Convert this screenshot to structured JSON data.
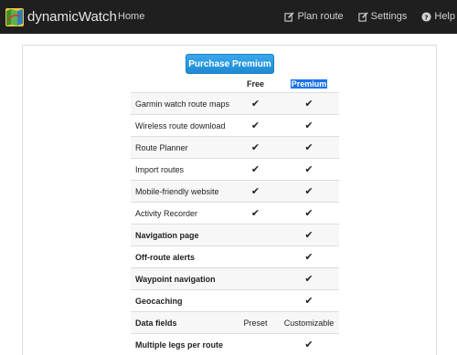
{
  "navbar": {
    "brand": "dynamicWatch",
    "home": "Home",
    "plan_route": "Plan route",
    "settings": "Settings",
    "help": "Help"
  },
  "purchase_button": "Purchase Premium",
  "table": {
    "headers": {
      "free": "Free",
      "premium": "Premium"
    },
    "rows": [
      {
        "label": "Garmin watch route maps",
        "free": "✔",
        "premium": "✔",
        "bold": false
      },
      {
        "label": "Wireless route download",
        "free": "✔",
        "premium": "✔",
        "bold": false
      },
      {
        "label": "Route Planner",
        "free": "✔",
        "premium": "✔",
        "bold": false
      },
      {
        "label": "Import routes",
        "free": "✔",
        "premium": "✔",
        "bold": false
      },
      {
        "label": "Mobile-friendly website",
        "free": "✔",
        "premium": "✔",
        "bold": false
      },
      {
        "label": "Activity Recorder",
        "free": "✔",
        "premium": "✔",
        "bold": false
      },
      {
        "label": "Navigation page",
        "free": "",
        "premium": "✔",
        "bold": true
      },
      {
        "label": "Off-route alerts",
        "free": "",
        "premium": "✔",
        "bold": true
      },
      {
        "label": "Waypoint navigation",
        "free": "",
        "premium": "✔",
        "bold": true
      },
      {
        "label": "Geocaching",
        "free": "",
        "premium": "✔",
        "bold": true
      },
      {
        "label": "Data fields",
        "free": "Preset",
        "premium": "Customizable",
        "bold": true
      },
      {
        "label": "Multiple legs per route",
        "free": "",
        "premium": "✔",
        "bold": true
      }
    ]
  },
  "colors": {
    "navbar_bg": "#1f1f1f",
    "button_blue": "#1d8ad3",
    "selection_blue": "#1a73e8"
  },
  "icons": {
    "logo": "map-logo-icon",
    "plan_route": "edit-icon",
    "settings": "edit-icon",
    "help": "question-circle-icon",
    "check": "checkmark-icon"
  }
}
